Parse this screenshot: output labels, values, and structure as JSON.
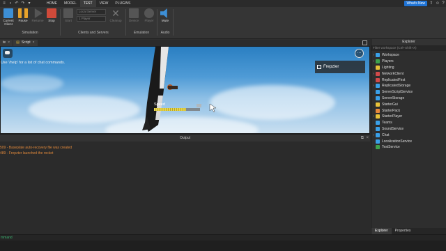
{
  "menu": {
    "tabs": [
      "HOME",
      "MODEL",
      "TEST",
      "VIEW",
      "PLUGINS"
    ],
    "active_tab": "TEST",
    "whats_new": "What's New"
  },
  "ribbon": {
    "buttons": {
      "current_client": "Current\nClient",
      "pause": "Pause",
      "resume": "Resume",
      "stop": "Stop",
      "start": "Start",
      "cleanup": "Cleanup",
      "device": "Device",
      "player": "Player",
      "mute": "Mute"
    },
    "dropdowns": {
      "server": "Local Server",
      "players": "1 Player"
    },
    "groups": {
      "simulation": "Simulation",
      "clients_servers": "Clients and Servers",
      "emulation": "Emulation",
      "audio": "Audio"
    }
  },
  "doc_tabs": [
    {
      "label": "te",
      "closable": true
    },
    {
      "label": "Script",
      "closable": true
    }
  ],
  "viewport": {
    "chat_hint": "Use '/help' for a list of chat commands.",
    "player_card": "Frepzter",
    "speed_label": "Speed",
    "speed_fraction": 0.7
  },
  "output": {
    "title": "Output",
    "lines": [
      {
        "text": "509 - Baseplate auto-recovery file was created",
        "color": "#e0883a"
      },
      {
        "text": "489 - Frepzter launched the rocket",
        "color": "#e0883a"
      }
    ]
  },
  "explorer": {
    "title": "Explorer",
    "filter_placeholder": "Filter workspace (Ctrl+Shift+X)",
    "items": [
      {
        "label": "Workspace",
        "arrow": true,
        "icon_color": "#3aa0e8"
      },
      {
        "label": "Players",
        "arrow": true,
        "icon_color": "#3fa34d"
      },
      {
        "label": "Lighting",
        "arrow": false,
        "icon_color": "#e8c23a"
      },
      {
        "label": "NetworkClient",
        "arrow": true,
        "icon_color": "#d04a4a"
      },
      {
        "label": "ReplicatedFirst",
        "arrow": false,
        "icon_color": "#d04a4a"
      },
      {
        "label": "ReplicatedStorage",
        "arrow": true,
        "icon_color": "#3aa0e8"
      },
      {
        "label": "ServerScriptService",
        "arrow": false,
        "icon_color": "#3aa0e8"
      },
      {
        "label": "ServerStorage",
        "arrow": false,
        "icon_color": "#3aa0e8"
      },
      {
        "label": "StarterGui",
        "arrow": false,
        "icon_color": "#e8c23a"
      },
      {
        "label": "StarterPack",
        "arrow": false,
        "icon_color": "#e8883a"
      },
      {
        "label": "StarterPlayer",
        "arrow": true,
        "icon_color": "#e8c23a"
      },
      {
        "label": "Teams",
        "arrow": false,
        "icon_color": "#3aa0e8"
      },
      {
        "label": "SoundService",
        "arrow": false,
        "icon_color": "#3aa0e8"
      },
      {
        "label": "Chat",
        "arrow": true,
        "icon_color": "#3aa0e8"
      },
      {
        "label": "LocalizationService",
        "arrow": false,
        "icon_color": "#3aa0e8"
      },
      {
        "label": "TestService",
        "arrow": false,
        "icon_color": "#3fa34d"
      }
    ],
    "tabs": [
      "Explorer",
      "Properties"
    ],
    "active_tab": "Explorer"
  },
  "command_bar": {
    "text": "mmand"
  },
  "colors": {
    "accent": "#1f74d6",
    "stop": "#d04a3a",
    "pause": "#e8a22a",
    "output_text": "#e0883a"
  }
}
